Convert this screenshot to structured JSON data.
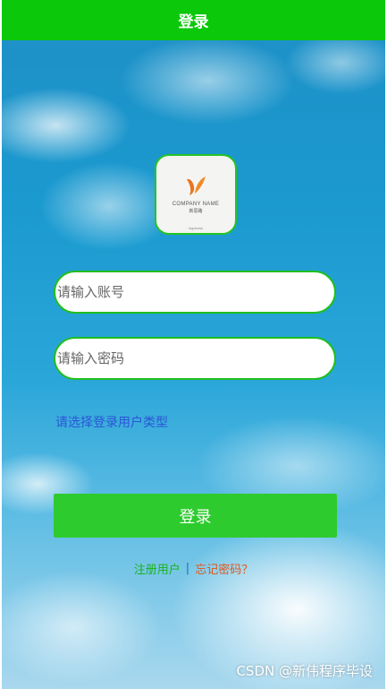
{
  "header": {
    "title": "登录"
  },
  "logo": {
    "company": "COMPANY NAME",
    "subtitle": "新思路",
    "tagline": "logoboss",
    "icon": "leaf-logo-icon"
  },
  "form": {
    "account_placeholder": "请输入账号",
    "password_placeholder": "请输入密码",
    "user_type_label": "请选择登录用户类型",
    "login_button": "登录"
  },
  "links": {
    "register": "注册用户",
    "separator": "|",
    "forgot": "忘记密码？"
  },
  "watermark": "CSDN @新伟程序毕设",
  "colors": {
    "accent": "#0bc80b",
    "button": "#2ecb2e",
    "link_blue": "#2a56d6",
    "link_orange": "#e0571b"
  }
}
